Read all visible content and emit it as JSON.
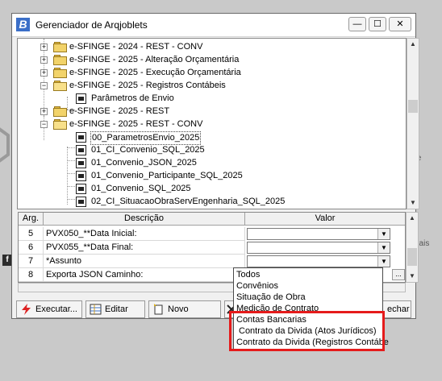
{
  "window": {
    "title": "Gerenciador de Arqjoblets",
    "icon_letter": "B",
    "min_glyph": "—",
    "max_glyph": "☐",
    "close_glyph": "✕"
  },
  "background": {
    "fb_letter": "f",
    "text1": "te",
    "text2": "nais"
  },
  "tree": {
    "items": [
      {
        "label": "e-SFINGE - 2024 - REST - CONV",
        "type": "folder",
        "expander": "+"
      },
      {
        "label": "e-SFINGE - 2025 - Alteração Orçamentária",
        "type": "folder",
        "expander": "+"
      },
      {
        "label": "e-SFINGE - 2025 - Execução Orçamentária",
        "type": "folder",
        "expander": "+"
      },
      {
        "label": "e-SFINGE - 2025 - Registros Contábeis",
        "type": "folder-open",
        "expander": "−"
      },
      {
        "label": "Parâmetros de Envio",
        "type": "doc",
        "expander": ""
      },
      {
        "label": "e-SFINGE - 2025 - REST",
        "type": "folder",
        "expander": "+"
      },
      {
        "label": "e-SFINGE - 2025 - REST - CONV",
        "type": "folder-open",
        "expander": "−"
      },
      {
        "label": "00_ParametrosEnvio_2025",
        "type": "doc",
        "expander": ""
      },
      {
        "label": "01_CI_Convenio_SQL_2025",
        "type": "doc",
        "expander": ""
      },
      {
        "label": "01_Convenio_JSON_2025",
        "type": "doc",
        "expander": ""
      },
      {
        "label": "01_Convenio_Participante_SQL_2025",
        "type": "doc",
        "expander": ""
      },
      {
        "label": "01_Convenio_SQL_2025",
        "type": "doc",
        "expander": ""
      },
      {
        "label": "02_CI_SituacaoObraServEngenharia_SQL_2025",
        "type": "doc",
        "expander": ""
      }
    ]
  },
  "grid": {
    "headers": {
      "arg": "Arg.",
      "descricao": "Descrição",
      "valor": "Valor"
    },
    "rows": [
      {
        "arg": "5",
        "descricao": "PVX050_**Data Inicial:",
        "valor": ""
      },
      {
        "arg": "6",
        "descricao": "PVX055_**Data Final:",
        "valor": ""
      },
      {
        "arg": "7",
        "descricao": "*Assunto",
        "valor": ""
      },
      {
        "arg": "8",
        "descricao": "Exporta JSON Caminho:",
        "valor": ""
      }
    ],
    "ellipsis": "..."
  },
  "toolbar": {
    "executar": "Executar...",
    "editar": "Editar",
    "novo": "Novo",
    "fechar": "echar"
  },
  "dropdown": {
    "options": [
      "Todos",
      "Convênios",
      "Situação de Obra",
      "Medição de Contrato",
      "Contas Bancarias",
      "Contrato da Divida (Atos Jurídicos)",
      "Contrato da Divida (Registros Contábe"
    ]
  },
  "colors": {
    "highlight": "#e51b1b",
    "title_icon": "#3b6fc8"
  }
}
